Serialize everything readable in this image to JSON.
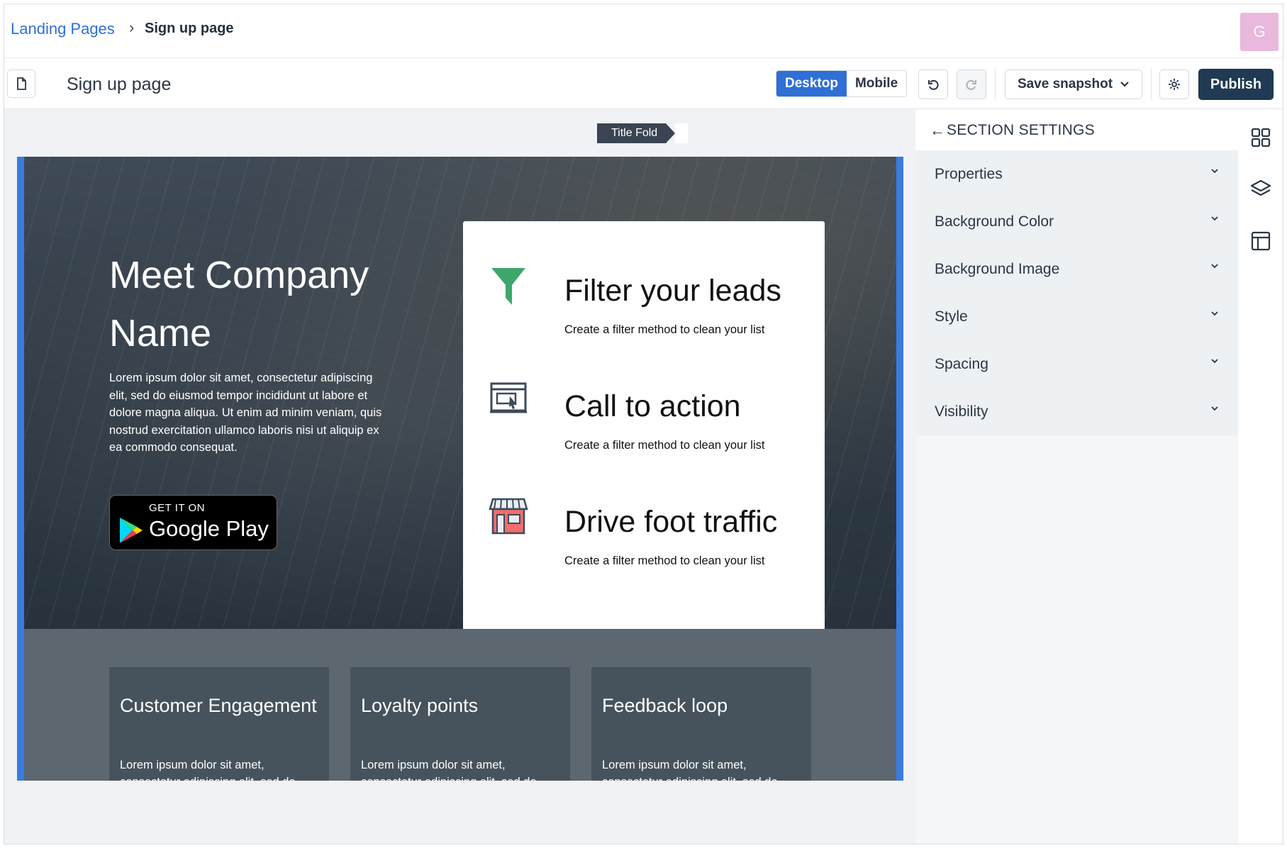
{
  "breadcrumb": {
    "parent": "Landing Pages",
    "separator": "›",
    "current": "Sign up page"
  },
  "user": {
    "avatar_initial": "G"
  },
  "toolbar": {
    "page_name": "Sign up page",
    "device_desktop": "Desktop",
    "device_mobile": "Mobile",
    "active_device": "Desktop",
    "save_snapshot": "Save snapshot",
    "publish": "Publish"
  },
  "canvas": {
    "fold_tag": "Title Fold",
    "hero": {
      "title": "Meet Company Name",
      "body": "Lorem ipsum dolor sit amet, consectetur adipiscing elit, sed do eiusmod tempor incididunt ut labore et dolore magna aliqua. Ut enim ad minim veniam, quis nostrud exercitation ullamco laboris nisi ut aliquip ex ea commodo consequat.",
      "store_badge": {
        "line1": "GET IT ON",
        "line2": "Google Play"
      }
    },
    "features": [
      {
        "title": "Filter your leads",
        "desc": "Create a filter method to clean your list",
        "icon": "funnel-icon"
      },
      {
        "title": "Call to action",
        "desc": "Create a filter method to clean your list",
        "icon": "click-screen-icon"
      },
      {
        "title": "Drive foot traffic",
        "desc": "Create a filter method to clean your list",
        "icon": "storefront-icon"
      }
    ],
    "cards": [
      {
        "title": "Customer Engagement",
        "body": "Lorem ipsum dolor sit amet, consectetur adipiscing elit, sed do"
      },
      {
        "title": "Loyalty points",
        "body": "Lorem ipsum dolor sit amet, consectetur adipiscing elit, sed do"
      },
      {
        "title": "Feedback loop",
        "body": "Lorem ipsum dolor sit amet, consectetur adipiscing elit, sed do"
      }
    ]
  },
  "settings": {
    "back_arrow": "←",
    "title": "SECTION SETTINGS",
    "items": [
      {
        "label": "Properties"
      },
      {
        "label": "Background Color"
      },
      {
        "label": "Background Image"
      },
      {
        "label": "Style"
      },
      {
        "label": "Spacing"
      },
      {
        "label": "Visibility"
      }
    ]
  },
  "rail": [
    {
      "icon": "grid-icon"
    },
    {
      "icon": "layers-icon"
    },
    {
      "icon": "layout-icon"
    }
  ],
  "colors": {
    "accent": "#2f6fd6",
    "publish": "#1f3a52",
    "section_outline": "#3b7be0",
    "funnel": "#3fa66b"
  }
}
